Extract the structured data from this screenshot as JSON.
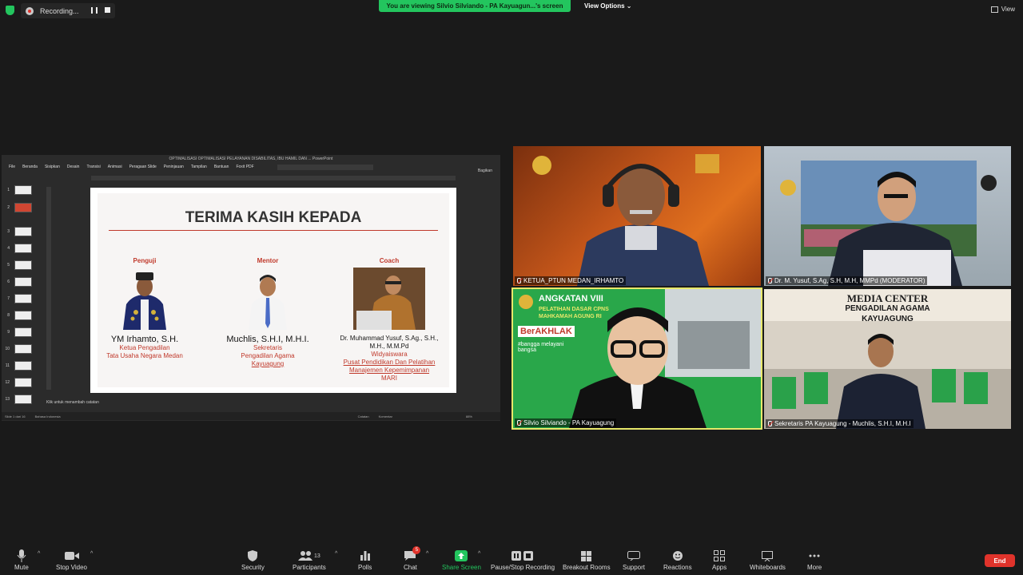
{
  "top": {
    "recording_label": "Recording...",
    "viewing_banner": "You are viewing Silvio Silviando - PA Kayuagun...'s screen",
    "view_options": "View Options",
    "view_button": "View"
  },
  "ppt": {
    "window_title": "OPTIMALISASI OPTIMALISASI PELAYANAN DISABILITAS, IBU HAMIL DAN ... PowerPoint",
    "menu": [
      "File",
      "Beranda",
      "Sisipkan",
      "Desain",
      "Transisi",
      "Animasi",
      "Peragaan Slide",
      "Peninjauan",
      "Tampilan",
      "Bantuan",
      "Foxit PDF"
    ],
    "share": "Bagikan",
    "thumbnails": [
      "1",
      "2",
      "3",
      "4",
      "5",
      "6",
      "7",
      "8",
      "9",
      "10",
      "11",
      "12",
      "13"
    ],
    "notes_placeholder": "Klik untuk menambah catatan",
    "status_slide": "Slide 1 dari 16",
    "status_lang": "Bahasa Indonesia",
    "status_notes": "Catatan",
    "status_comments": "Komentar",
    "zoom_pct": "88%",
    "slide": {
      "title": "TERIMA KASIH KEPADA",
      "people": [
        {
          "role": "Penguji",
          "name": "YM Irhamto, S.H.",
          "desc1": "Ketua Pengadilan",
          "desc2": "Tata Usaha Negara Medan",
          "desc3": "",
          "desc4": ""
        },
        {
          "role": "Mentor",
          "name": "Muchlis, S.H.I, M.H.I.",
          "desc1": "Sekretaris",
          "desc2": "Pengadilan Agama",
          "desc3": "Kayuagung",
          "desc4": ""
        },
        {
          "role": "Coach",
          "name": "Dr. Muhammad Yusuf, S.Ag., S.H., M.H., M.M.Pd",
          "desc1": "Widyaiswara",
          "desc2": "Pusat Pendidikan Dan Pelatihan",
          "desc3": "Manajemen Kepemimpanan",
          "desc4": "MARI"
        }
      ]
    }
  },
  "tiles": [
    {
      "name": "KETUA_PTUN MEDAN_IRHAMTO"
    },
    {
      "name": "Dr. M. Yusuf, S.Ag, S.H, M.H, MMPd (MODERATOR)"
    },
    {
      "name": "Silvio Silviando - PA Kayuagung",
      "banner1": "ANGKATAN VIII",
      "banner2": "PELATIHAN DASAR CPNS",
      "banner3": "MAHKAMAH AGUNG RI",
      "tag": "BerAKHLAK",
      "hashtag": "#bangga melayani bangsa"
    },
    {
      "name": "Sekretaris PA Kayuagung - Muchlis, S.H.I, M.H.I",
      "sign1": "MEDIA CENTER",
      "sign2": "PENGADILAN AGAMA",
      "sign3": "KAYUAGUNG"
    }
  ],
  "toolbar": {
    "mute": "Mute",
    "stop_video": "Stop Video",
    "security": "Security",
    "participants": "Participants",
    "participants_count": "13",
    "polls": "Polls",
    "chat": "Chat",
    "chat_badge": "5",
    "share_screen": "Share Screen",
    "pause_recording": "Pause/Stop Recording",
    "breakout": "Breakout Rooms",
    "support": "Support",
    "reactions": "Reactions",
    "apps": "Apps",
    "whiteboards": "Whiteboards",
    "more": "More",
    "end": "End"
  },
  "colors": {
    "accent_green": "#23c55e",
    "end_red": "#e0332b",
    "slide_red": "#c0392b"
  }
}
